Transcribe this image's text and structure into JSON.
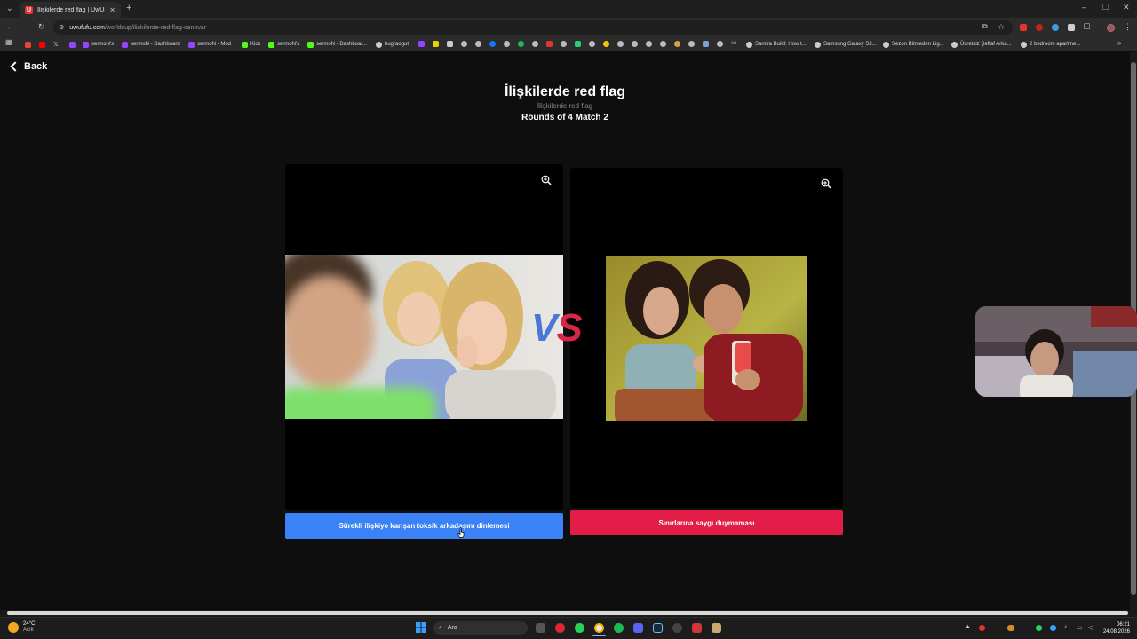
{
  "browser": {
    "tab_title": "İlişkilerde red flag | UwUFUFU",
    "tab_favicon": "U",
    "new_tab": "+",
    "url_host": "uwufufu.com",
    "url_path": "/worldcup/ilişkilerde-red-flag-canovar",
    "window_controls": [
      "–",
      "❐",
      "✕"
    ]
  },
  "bookmarks": [
    {
      "label": "",
      "icon": "gmail-icon",
      "color": "#ea4335"
    },
    {
      "label": "",
      "icon": "youtube-icon",
      "color": "#ff0000"
    },
    {
      "label": "",
      "icon": "x-icon",
      "color": "#cccccc"
    },
    {
      "label": "sermoN's",
      "icon": "twitch-icon",
      "color": "#9146ff"
    },
    {
      "label": "sermoN - Dashboard",
      "icon": "twitch-icon",
      "color": "#9146ff"
    },
    {
      "label": "sermoN - Mod",
      "icon": "twitch-icon",
      "color": "#9146ff"
    },
    {
      "label": "Kick",
      "icon": "kick-icon",
      "color": "#53fc18"
    },
    {
      "label": "sermoN's",
      "icon": "kick-icon",
      "color": "#53fc18"
    },
    {
      "label": "sermoN - Dashboar...",
      "icon": "kick-icon",
      "color": "#53fc18"
    },
    {
      "label": "bugraogut",
      "icon": "globe-icon",
      "color": "#cccccc"
    },
    {
      "label": "Samira Build: How t...",
      "icon": "globe-icon",
      "color": "#cccccc"
    },
    {
      "label": "Samsung Galaxy S2...",
      "icon": "globe-icon",
      "color": "#cccccc"
    },
    {
      "label": "Sezon Bitmeden Lig...",
      "icon": "globe-icon",
      "color": "#cccccc"
    },
    {
      "label": "Ücretsiz Şeffaf Arka...",
      "icon": "globe-icon",
      "color": "#cccccc"
    },
    {
      "label": "2 bedroom apartme...",
      "icon": "globe-icon",
      "color": "#cccccc"
    }
  ],
  "page": {
    "back_label": "Back",
    "title": "İlişkilerde red flag",
    "subtitle": "İlişkilerde red flag",
    "rounds": "Rounds of 4 Match 2",
    "vs_v": "V",
    "vs_s": "S"
  },
  "candidates": [
    {
      "label": "Sürekli ilişkiye karışan toksik arkadaşını dinlemesi",
      "color": "#3b82f6"
    },
    {
      "label": "Sınırlarına saygı duymaması",
      "color": "#e11d48"
    }
  ],
  "taskbar": {
    "temperature": "24°C",
    "weather_text": "Açık",
    "search_placeholder": "Ara",
    "time": "06:21",
    "date": "24.08.2026"
  }
}
